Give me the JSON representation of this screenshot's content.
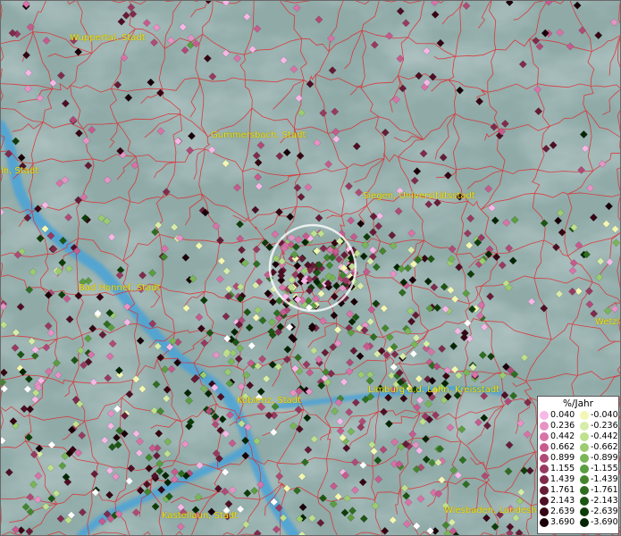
{
  "cities": [
    {
      "id": "wuppertal",
      "label": "Wuppertal, Stadt"
    },
    {
      "id": "gummersbach",
      "label": "Gummersbach, Stadt"
    },
    {
      "id": "koeln",
      "label": "ln, Stadt"
    },
    {
      "id": "siegen",
      "label": "Siegen, Universitätsstadt"
    },
    {
      "id": "bad-honnef",
      "label": "Bad Honnef, Stadt"
    },
    {
      "id": "koblenz",
      "label": "Koblenz, Stadt"
    },
    {
      "id": "limburg",
      "label": "Limburg a.d. Lahn, Kreisstadt"
    },
    {
      "id": "wetzlar",
      "label": "Wetzl"
    },
    {
      "id": "kastellaun",
      "label": "Kastellaun, Stadt"
    },
    {
      "id": "wiesbaden",
      "label": "Wiesbaden, Landesh"
    }
  ],
  "legend": {
    "title": "%/Jahr",
    "positive": [
      {
        "label": "0.040",
        "color": "#f6b8e6"
      },
      {
        "label": "0.236",
        "color": "#e793c6"
      },
      {
        "label": "0.442",
        "color": "#d873a8"
      },
      {
        "label": "0.662",
        "color": "#c65b8e"
      },
      {
        "label": "0.899",
        "color": "#b04a76"
      },
      {
        "label": "1.155",
        "color": "#983a60"
      },
      {
        "label": "1.439",
        "color": "#802b4c"
      },
      {
        "label": "1.761",
        "color": "#661c36"
      },
      {
        "label": "2.143",
        "color": "#4e0f24"
      },
      {
        "label": "2.639",
        "color": "#360613"
      },
      {
        "label": "3.690",
        "color": "#1a0008"
      }
    ],
    "negative": [
      {
        "label": "-0.040",
        "color": "#f3f7b4"
      },
      {
        "label": "-0.236",
        "color": "#d8ecaa"
      },
      {
        "label": "-0.442",
        "color": "#bfe08f"
      },
      {
        "label": "-0.662",
        "color": "#9ccc72"
      },
      {
        "label": "-0.899",
        "color": "#7ab558"
      },
      {
        "label": "-1.155",
        "color": "#5b9d40"
      },
      {
        "label": "-1.439",
        "color": "#44852e"
      },
      {
        "label": "-1.761",
        "color": "#2f6d20"
      },
      {
        "label": "-2.143",
        "color": "#1d5513"
      },
      {
        "label": "-2.639",
        "color": "#0f3d09"
      },
      {
        "label": "-3.690",
        "color": "#052503"
      }
    ]
  },
  "colors": {
    "terrain": "#8fa9a8",
    "river": "#4aa3d8",
    "boundary": "#e0282c",
    "city_label": "#f2e21a",
    "highlight_ring": "#ffffff"
  }
}
